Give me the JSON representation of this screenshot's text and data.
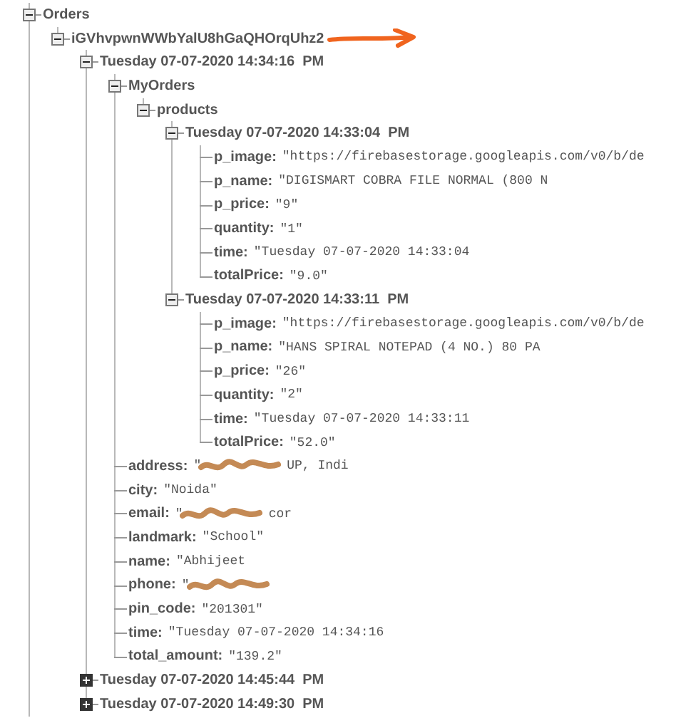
{
  "tree": [
    {
      "key": "Orders",
      "expanded": true,
      "children": [
        {
          "key": "iGVhvpwnWWbYalU8hGaQHOrqUhz2",
          "expanded": true,
          "arrow_marked": true,
          "children": [
            {
              "key": "Tuesday 07-07-2020 14:34:16  PM",
              "expanded": true,
              "children": [
                {
                  "key": "MyOrders",
                  "expanded": true,
                  "children": [
                    {
                      "key": "products",
                      "expanded": true,
                      "children": [
                        {
                          "key": "Tuesday 07-07-2020 14:33:04  PM",
                          "expanded": true,
                          "children": [
                            {
                              "key": "p_image:",
                              "value": "\"https://firebasestorage.googleapis.com/v0/b/de"
                            },
                            {
                              "key": "p_name:",
                              "value": "\"DIGISMART COBRA FILE NORMAL (800 N"
                            },
                            {
                              "key": "p_price:",
                              "value": "\"9\""
                            },
                            {
                              "key": "quantity:",
                              "value": "\"1\""
                            },
                            {
                              "key": "time:",
                              "value": "\"Tuesday 07-07-2020 14:33:04"
                            },
                            {
                              "key": "totalPrice:",
                              "value": "\"9.0\""
                            }
                          ]
                        },
                        {
                          "key": "Tuesday 07-07-2020 14:33:11  PM",
                          "expanded": true,
                          "children": [
                            {
                              "key": "p_image:",
                              "value": "\"https://firebasestorage.googleapis.com/v0/b/de"
                            },
                            {
                              "key": "p_name:",
                              "value": "\"HANS SPIRAL NOTEPAD (4 NO.) 80 PA"
                            },
                            {
                              "key": "p_price:",
                              "value": "\"26\""
                            },
                            {
                              "key": "quantity:",
                              "value": "\"2\""
                            },
                            {
                              "key": "time:",
                              "value": "\"Tuesday 07-07-2020 14:33:11"
                            },
                            {
                              "key": "totalPrice:",
                              "value": "\"52.0\""
                            }
                          ]
                        }
                      ]
                    }
                  ]
                },
                {
                  "key": "address:",
                  "value": "\"",
                  "redacted": true,
                  "value_end": "UP, Indi"
                },
                {
                  "key": "city:",
                  "value": "\"Noida\""
                },
                {
                  "key": "email:",
                  "value": "\"",
                  "redacted": true,
                  "value_end": "cor"
                },
                {
                  "key": "landmark:",
                  "value": "\"School\""
                },
                {
                  "key": "name:",
                  "value": "\"Abhijeet"
                },
                {
                  "key": "phone:",
                  "value": "\"",
                  "redacted": true
                },
                {
                  "key": "pin_code:",
                  "value": "\"201301\""
                },
                {
                  "key": "time:",
                  "value": "\"Tuesday 07-07-2020 14:34:16"
                },
                {
                  "key": "total_amount:",
                  "value": "\"139.2\""
                }
              ]
            },
            {
              "key": "Tuesday 07-07-2020 14:45:44  PM",
              "expanded": false
            },
            {
              "key": "Tuesday 07-07-2020 14:49:30  PM",
              "expanded": false
            }
          ]
        }
      ]
    }
  ]
}
